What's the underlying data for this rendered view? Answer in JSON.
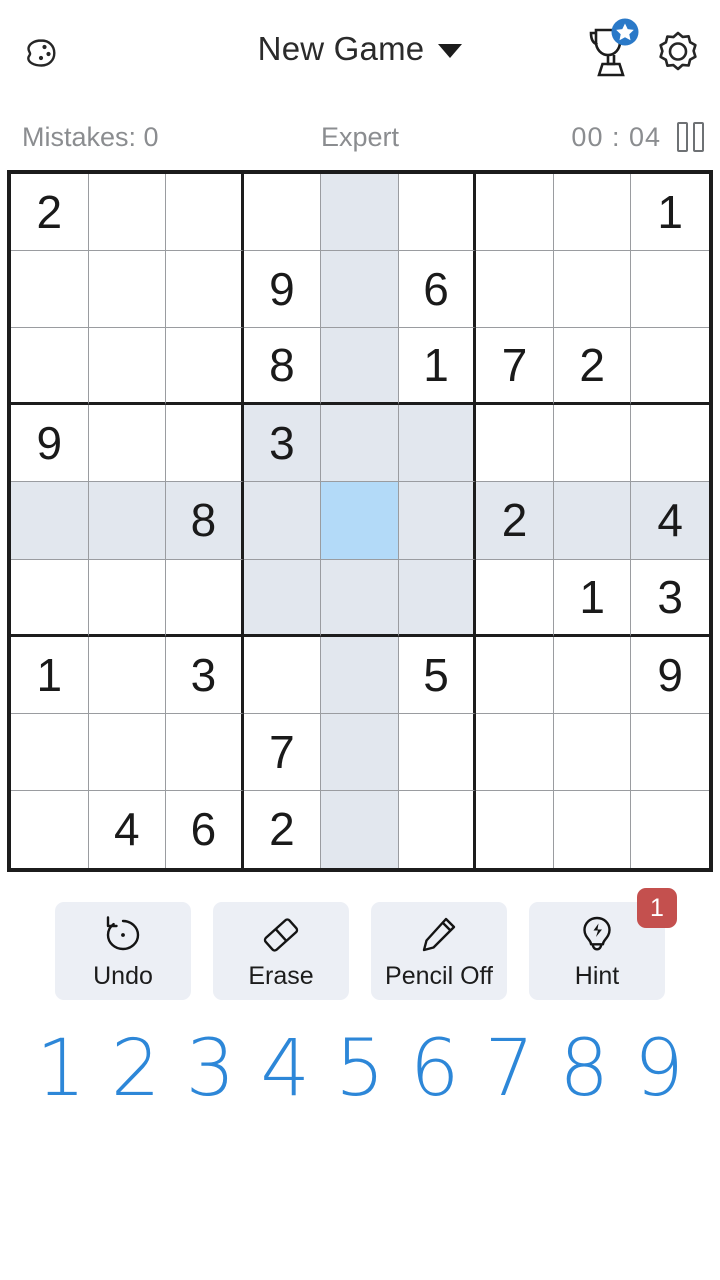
{
  "header": {
    "palette_icon": "palette-icon",
    "title": "New Game",
    "caret_icon": "chevron-down-icon",
    "trophy_icon": "trophy-star-icon",
    "gear_icon": "gear-icon"
  },
  "status": {
    "mistakes": "Mistakes: 0",
    "difficulty": "Expert",
    "timer": "00 : 04",
    "pause_icon": "pause-icon"
  },
  "board": {
    "selected": {
      "row": 4,
      "col": 4
    },
    "highlight_color": "#e2e7ee",
    "selected_color": "#b3daf8",
    "rows": [
      [
        "2",
        "",
        "",
        "",
        "",
        "",
        "",
        "",
        "1"
      ],
      [
        "",
        "",
        "",
        "9",
        "",
        "6",
        "",
        "",
        ""
      ],
      [
        "",
        "",
        "",
        "8",
        "",
        "1",
        "7",
        "2",
        ""
      ],
      [
        "9",
        "",
        "",
        "3",
        "",
        "",
        "",
        "",
        ""
      ],
      [
        "",
        "",
        "8",
        "",
        "",
        "",
        "2",
        "",
        "4"
      ],
      [
        "",
        "",
        "",
        "",
        "",
        "",
        "",
        "1",
        "3"
      ],
      [
        "1",
        "",
        "3",
        "",
        "",
        "5",
        "",
        "",
        "9"
      ],
      [
        "",
        "",
        "",
        "7",
        "",
        "",
        "",
        "",
        ""
      ],
      [
        "",
        "4",
        "6",
        "2",
        "",
        "",
        "",
        "",
        ""
      ]
    ]
  },
  "actions": [
    {
      "label": "Undo",
      "icon": "undo-icon",
      "badge": ""
    },
    {
      "label": "Erase",
      "icon": "eraser-icon",
      "badge": ""
    },
    {
      "label": "Pencil Off",
      "icon": "pencil-icon",
      "badge": ""
    },
    {
      "label": "Hint",
      "icon": "lightbulb-icon",
      "badge": "1"
    }
  ],
  "numpad": [
    "1",
    "2",
    "3",
    "4",
    "5",
    "6",
    "7",
    "8",
    "9"
  ],
  "colors": {
    "accent_blue": "#2d87d8",
    "badge_red": "#c4504e",
    "button_bg": "#eceff5",
    "muted_text": "#8b8d90"
  }
}
